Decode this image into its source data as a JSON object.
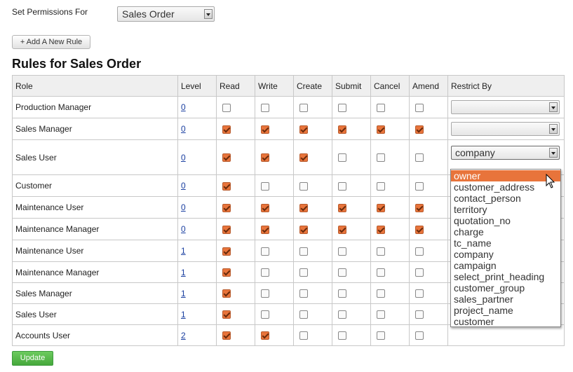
{
  "header": {
    "set_permissions_label": "Set Permissions For",
    "doctype_selected": "Sales Order",
    "add_rule_label": "+ Add A New Rule",
    "rules_title": "Rules for Sales Order"
  },
  "table": {
    "columns": [
      "Role",
      "Level",
      "Read",
      "Write",
      "Create",
      "Submit",
      "Cancel",
      "Amend",
      "Restrict By"
    ],
    "rows": [
      {
        "role": "Production Manager",
        "level": "0",
        "perms": [
          false,
          false,
          false,
          false,
          false,
          false
        ],
        "restrict": ""
      },
      {
        "role": "Sales Manager",
        "level": "0",
        "perms": [
          true,
          true,
          true,
          true,
          true,
          true
        ],
        "restrict": ""
      },
      {
        "role": "Sales User",
        "level": "0",
        "perms": [
          true,
          true,
          true,
          false,
          false,
          false
        ],
        "restrict": "company"
      },
      {
        "role": "Customer",
        "level": "0",
        "perms": [
          true,
          false,
          false,
          false,
          false,
          false
        ],
        "restrict": null
      },
      {
        "role": "Maintenance User",
        "level": "0",
        "perms": [
          true,
          true,
          true,
          true,
          true,
          true
        ],
        "restrict": null
      },
      {
        "role": "Maintenance Manager",
        "level": "0",
        "perms": [
          true,
          true,
          true,
          true,
          true,
          true
        ],
        "restrict": null
      },
      {
        "role": "Maintenance User",
        "level": "1",
        "perms": [
          true,
          false,
          false,
          false,
          false,
          false
        ],
        "restrict": null
      },
      {
        "role": "Maintenance Manager",
        "level": "1",
        "perms": [
          true,
          false,
          false,
          false,
          false,
          false
        ],
        "restrict": null
      },
      {
        "role": "Sales Manager",
        "level": "1",
        "perms": [
          true,
          false,
          false,
          false,
          false,
          false
        ],
        "restrict": null
      },
      {
        "role": "Sales User",
        "level": "1",
        "perms": [
          true,
          false,
          false,
          false,
          false,
          false
        ],
        "restrict": null
      },
      {
        "role": "Accounts User",
        "level": "2",
        "perms": [
          true,
          true,
          false,
          false,
          false,
          false
        ],
        "restrict": null
      }
    ]
  },
  "dropdown": {
    "options": [
      "owner",
      "customer_address",
      "contact_person",
      "territory",
      "quotation_no",
      "charge",
      "tc_name",
      "company",
      "campaign",
      "select_print_heading",
      "customer_group",
      "sales_partner",
      "project_name",
      "customer"
    ],
    "highlighted": "owner"
  },
  "footer": {
    "update_label": "Update"
  },
  "colors": {
    "accent": "#e8743b",
    "update_button": "#46a83b",
    "link": "#1a3fa0"
  }
}
